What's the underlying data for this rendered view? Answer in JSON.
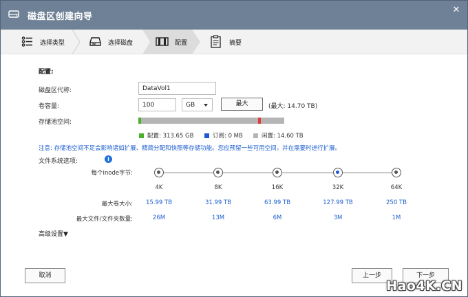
{
  "window": {
    "title": "磁盘区创建向导",
    "close_glyph": "✕"
  },
  "steps": [
    {
      "label": "选择类型",
      "icon": "list-icon"
    },
    {
      "label": "选择磁盘",
      "icon": "disk-icon"
    },
    {
      "label": "配置",
      "icon": "config-icon"
    },
    {
      "label": "摘要",
      "icon": "clipboard-icon"
    }
  ],
  "config": {
    "section_title": "配置:",
    "alias_label": "磁盘区代称:",
    "alias_value": "DataVol1",
    "capacity_label": "卷容量:",
    "capacity_value": "100",
    "capacity_unit": "GB",
    "max_button": "最大",
    "max_text": "(最大:  14.70 TB)",
    "pool_label": "存储池空间:",
    "pool": {
      "used_fraction": 0.02,
      "reserved_fraction": 0.82,
      "legend": [
        {
          "label": "配置:  313.65 GB",
          "color": "#4caf2e"
        },
        {
          "label": "订阅:  0 MB",
          "color": "#1f57d6"
        },
        {
          "label": "闲置:  14.60 TB",
          "color": "#b5b5b5"
        }
      ]
    },
    "note": "注意: 存储池空间不足会影响诸如扩展、精简分配和快照等存储功能。您应预留一些可用空间，并在需要时进行扩展。",
    "fs_label": "文件系统选项:",
    "info_glyph": "i",
    "inode_label": "每个inode字节:",
    "max_volume_label": "最大卷大小:",
    "max_files_label": "最大文件/文件夹数量:",
    "inode_options": [
      {
        "bytes": "4K",
        "max_volume": "15.99 TB",
        "max_files": "26M",
        "selected": false
      },
      {
        "bytes": "8K",
        "max_volume": "31.99 TB",
        "max_files": "13M",
        "selected": false
      },
      {
        "bytes": "16K",
        "max_volume": "63.99 TB",
        "max_files": "6M",
        "selected": false
      },
      {
        "bytes": "32K",
        "max_volume": "127.99 TB",
        "max_files": "3M",
        "selected": true
      },
      {
        "bytes": "64K",
        "max_volume": "250 TB",
        "max_files": "1M",
        "selected": false
      }
    ],
    "advanced_label": "高级设置▼"
  },
  "footer": {
    "cancel": "取消",
    "back": "上一步",
    "next": "下一步"
  },
  "watermark": "Hao4K.CN"
}
